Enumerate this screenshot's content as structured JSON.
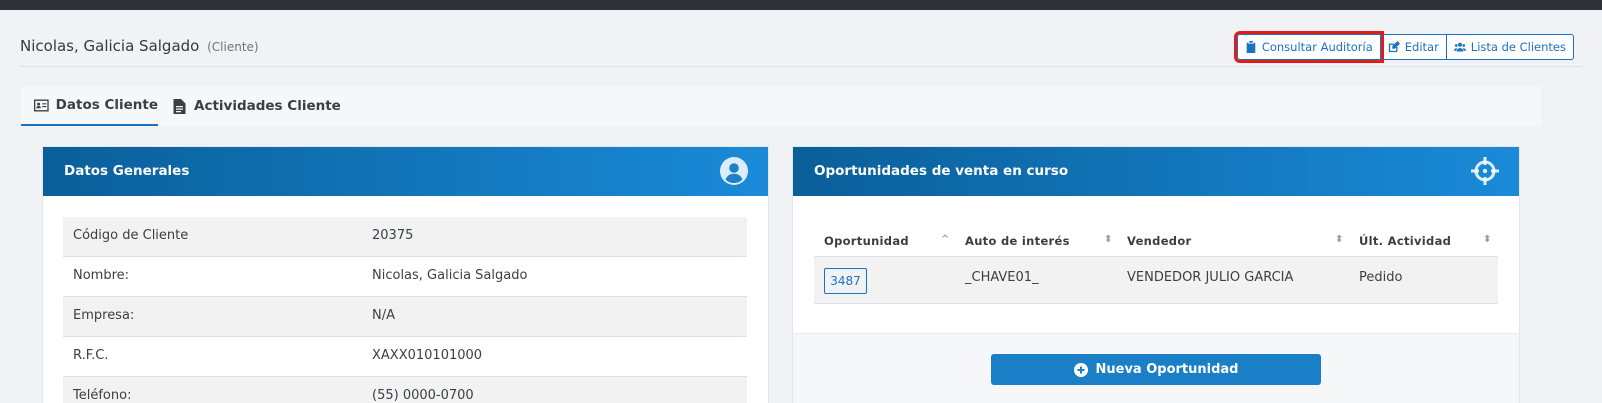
{
  "header": {
    "client_name": "Nicolas, Galicia Salgado",
    "client_role": "(Cliente)",
    "buttons": {
      "audit": "Consultar Auditoría",
      "edit": "Editar",
      "client_list": "Lista de Clientes"
    }
  },
  "tabs": [
    {
      "label": "Datos Cliente",
      "icon": "id-card-icon",
      "active": true
    },
    {
      "label": "Actividades Cliente",
      "icon": "file-icon",
      "active": false
    }
  ],
  "general": {
    "title": "Datos Generales",
    "icon": "user-circle-icon",
    "rows": [
      {
        "label": "Código de Cliente",
        "value": "20375"
      },
      {
        "label": "Nombre:",
        "value": "Nicolas, Galicia Salgado"
      },
      {
        "label": "Empresa:",
        "value": "N/A"
      },
      {
        "label": "R.F.C.",
        "value": "XAXX010101000"
      },
      {
        "label": "Teléfono:",
        "value": "(55) 0000-0700"
      }
    ]
  },
  "opportunities": {
    "title": "Oportunidades de venta en curso",
    "icon": "crosshairs-icon",
    "columns": [
      "Oportunidad",
      "Auto de interés",
      "Vendedor",
      "Últ. Actividad"
    ],
    "rows": [
      {
        "id": "3487",
        "car": "_CHAVE01_",
        "seller": "VENDEDOR JULIO GARCIA",
        "last_activity": "Pedido"
      }
    ],
    "new_button": "Nueva Oportunidad"
  },
  "colors": {
    "accent": "#1a73c2",
    "header_gradient_start": "#0a5f99",
    "header_gradient_end": "#1a8ad8",
    "highlight": "#e21b1b"
  }
}
